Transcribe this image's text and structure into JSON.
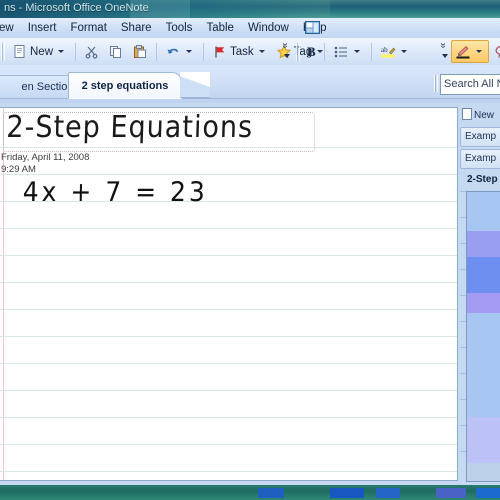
{
  "window": {
    "title": "ns - Microsoft Office OneNote"
  },
  "menu": {
    "items": [
      {
        "label": "ew",
        "icon": "menu-view"
      },
      {
        "label": "Insert",
        "icon": "menu-insert"
      },
      {
        "label": "Format",
        "icon": "menu-format"
      },
      {
        "label": "Share",
        "icon": "menu-share"
      },
      {
        "label": "Tools",
        "icon": "menu-tools"
      },
      {
        "label": "Table",
        "icon": "menu-table"
      },
      {
        "label": "Window",
        "icon": "menu-window"
      },
      {
        "label": "Help",
        "icon": "menu-help"
      }
    ],
    "trailing_icon": "window-restore-icon"
  },
  "toolbar": {
    "new_label": "New",
    "task_label": "Task",
    "tag_label": "Tag",
    "bold_label": "B",
    "icons": {
      "cut": "scissors-icon",
      "copy": "copy-icon",
      "paste": "paste-icon",
      "undo": "undo-arrow-icon",
      "task_flag": "red-flag-icon",
      "tag_star": "yellow-star-icon",
      "bullets": "bullet-list-icon",
      "highlight": "text-highlight-icon",
      "pen": "pen-icon",
      "lasso": "lasso-select-icon",
      "overflow": "toolbar-overflow-icon"
    },
    "pen_active": true
  },
  "tabs": {
    "inactive_label": "en Sectio...",
    "active_label": "2 step equations"
  },
  "search": {
    "placeholder": "Search All N",
    "value": "Search All N"
  },
  "page": {
    "title_ink": "2-Step Equations",
    "date": "Friday, April 11, 2008",
    "time": "9:29 AM",
    "equation_ink": "4x + 7 = 23"
  },
  "pagelist": {
    "new_page_label": "New",
    "items": [
      {
        "label": "Examp",
        "current": false
      },
      {
        "label": "Examp",
        "current": false
      },
      {
        "label": "2-Step",
        "current": true
      }
    ]
  },
  "colors": {
    "titlebar": "#1f5f78",
    "chrome": "#c5d9f1",
    "accent_active_tool": "#ffc866",
    "rule_line": "#d8e6e4",
    "margin_line": "#f2c5cb",
    "taskbar": "#1f6a60"
  }
}
